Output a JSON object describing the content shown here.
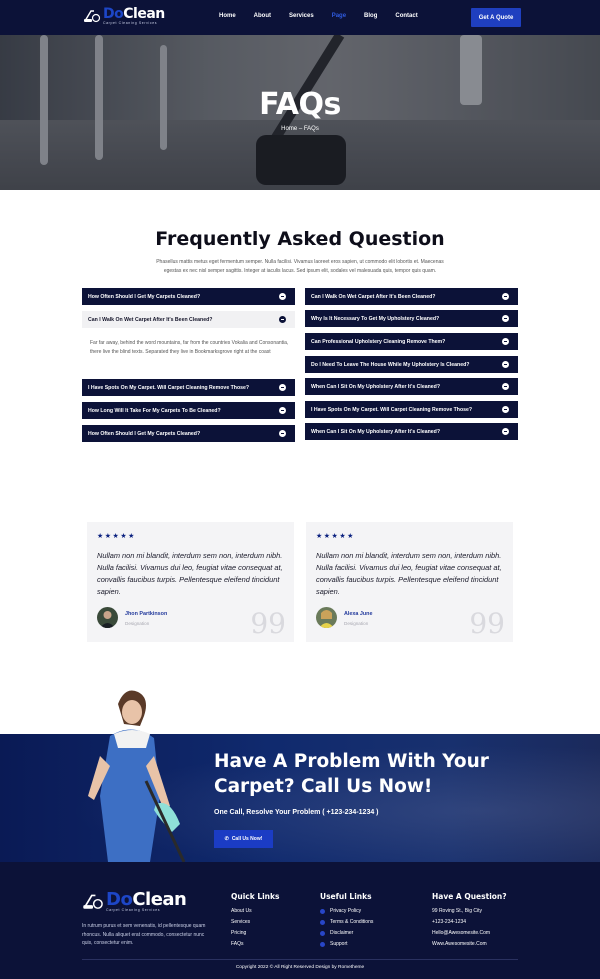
{
  "brand": {
    "name_do": "Do",
    "name_clean": "Clean",
    "tagline": "Carpet Cleaning Services"
  },
  "nav": {
    "links": [
      "Home",
      "About",
      "Services",
      "Page",
      "Blog",
      "Contact"
    ],
    "active": "Page",
    "cta": "Get A Quote"
  },
  "hero": {
    "title": "FAQs",
    "breadcrumb": "Home – FAQs"
  },
  "faq": {
    "title": "Frequently Asked Question",
    "subtitle": "Phasellus mattis metus eget fermentum semper. Nulla facilisi. Vivamus laoreet eros sapien, ut commodo elit lobortis et. Maecenas egestas ex nec nisl semper sagittis. Integer at iaculis lacus. Sed ipsum elit, sodales vel malesuada quis, tempor quis quam.",
    "left": [
      "How Often Should I Get My Carpets Cleaned?",
      "Can I Walk On Wet Carpet After It's Been Cleaned?",
      "I Have Spots On My Carpet. Will Carpet Cleaning Remove Those?",
      "How Long Will It Take For My Carpets To Be Cleaned?",
      "How Often Should I Get My Carpets Cleaned?"
    ],
    "open_answer": "Far far away, behind the word mountains, far from the countries Vokalia and Consonantia, there live the blind texts. Separated they live in Bookmarksgrove right at the coast",
    "right": [
      "Can I Walk On Wet Carpet After It's Been Cleaned?",
      "Why Is It Necessary To Get My Upholstery Cleaned?",
      "Can Professional Upholstery Cleaning Remove Them?",
      "Do I Need To Leave The House While My Upholstery Is Cleaned?",
      "When Can I Sit On My Upholstery After It's Cleaned?",
      "I Have Spots On My Carpet. Will Carpet Cleaning Remove Those?",
      "When Can I Sit On My Upholstery After It's Cleaned?"
    ]
  },
  "testimonials": [
    {
      "stars": "★★★★★",
      "quote": "Nullam non mi blandit, interdum sem non, interdum nibh. Nulla facilisi. Vivamus dui leo, feugiat vitae consequat at, convallis faucibus turpis. Pellentesque eleifend tincidunt sapien.",
      "name": "Jhon Partkinson",
      "role": "Designation",
      "mark": "99"
    },
    {
      "stars": "★★★★★",
      "quote": "Nullam non mi blandit, interdum sem non, interdum nibh. Nulla facilisi. Vivamus dui leo, feugiat vitae consequat at, convallis faucibus turpis. Pellentesque eleifend tincidunt sapien.",
      "name": "Alexa June",
      "role": "Designation",
      "mark": "99"
    }
  ],
  "cta": {
    "title": "Have A Problem With Your Carpet? Call Us Now!",
    "subtitle": "One Call, Resolve Your Problem ( +123-234-1234 )",
    "button": "Call Us Now!"
  },
  "footer": {
    "about": "In rutrum purus et sem venenatis, id pellentesque quam rhoncus. Nulla aliquet erat commodo, consectetur nunc quis, consectetur enim.",
    "quick_links": {
      "title": "Quick Links",
      "items": [
        "About Us",
        "Services",
        "Pricing",
        "FAQs"
      ]
    },
    "useful_links": {
      "title": "Useful Links",
      "items": [
        "Privacy Policy",
        "Terms & Conditions",
        "Disclaimer",
        "Support"
      ]
    },
    "contact": {
      "title": "Have A Question?",
      "items": [
        "99 Roving St., Big City",
        "+123-234-1234",
        "Hello@Awesomesite.Com",
        "Www.Awesomesite.Com"
      ]
    },
    "copyright": "Copyright 2022 © All Right Reserved Design by Rometheme"
  },
  "colors": {
    "navy": "#0c1238",
    "accent": "#1f3fbf"
  }
}
